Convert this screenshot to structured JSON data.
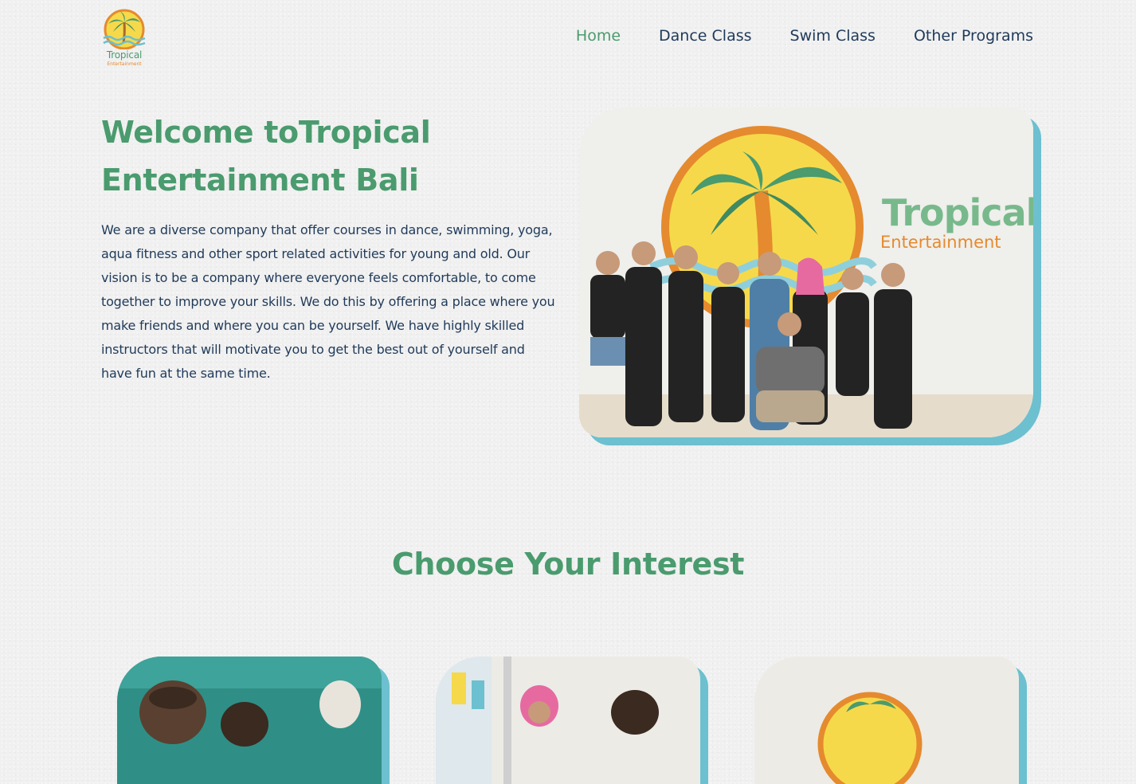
{
  "brand": {
    "logo_word": "Tropical",
    "logo_sub": "Entertainment",
    "colors": {
      "green": "#4a9b6e",
      "navy": "#1f3a5a",
      "teal": "#6cc0cf",
      "orange": "#e58a2e",
      "sun_yellow": "#f6d94a"
    }
  },
  "nav": {
    "items": [
      {
        "label": "Home",
        "active": true
      },
      {
        "label": "Dance Class",
        "active": false
      },
      {
        "label": "Swim Class",
        "active": false
      },
      {
        "label": "Other Programs",
        "active": false
      }
    ]
  },
  "hero": {
    "title": "Welcome toTropical Entertainment Bali",
    "description": "We are a diverse company that offer courses in dance, swimming, yoga, aqua fitness and other sport related activities for young and old. Our vision is to be a company where everyone feels comfortable, to come together to improve your skills. We do this by offering a place where you make friends and where you can be yourself. We have highly skilled instructors that will motivate you to get the best out of yourself and have fun at the same time.",
    "photo": {
      "wall_word": "Tropical",
      "wall_sub": "Entertainment"
    }
  },
  "interests": {
    "title": "Choose Your Interest"
  }
}
